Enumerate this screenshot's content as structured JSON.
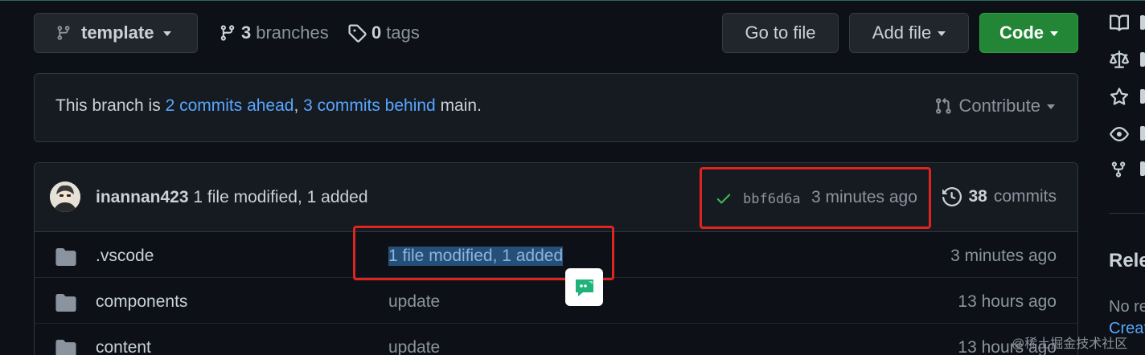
{
  "toolbar": {
    "branch_name": "template",
    "branches_count": "3",
    "branches_label": "branches",
    "tags_count": "0",
    "tags_label": "tags",
    "go_to_file": "Go to file",
    "add_file": "Add file",
    "code": "Code"
  },
  "branch_status": {
    "prefix": "This branch is ",
    "ahead": "2 commits ahead",
    "separator": ", ",
    "behind": "3 commits behind",
    "suffix": " main.",
    "contribute": "Contribute"
  },
  "latest_commit": {
    "author": "inannan423",
    "message": "1 file modified, 1 added",
    "sha": "bbf6d6a",
    "time": "3 minutes ago",
    "commits_count": "38",
    "commits_label": "commits"
  },
  "files": [
    {
      "name": ".vscode",
      "message": "1 file modified, 1 added",
      "time": "3 minutes ago"
    },
    {
      "name": "components",
      "message": "update",
      "time": "13 hours ago"
    },
    {
      "name": "content",
      "message": "update",
      "time": "13 hours ago"
    }
  ],
  "sidebar": {
    "releases_heading": "Rele",
    "no_releases": "No re",
    "create_link": "Create"
  },
  "watermark": "@稀土掘金技术社区",
  "colors": {
    "background": "#0d1117",
    "accent_link": "#58a6ff",
    "code_button": "#238636",
    "success": "#3fb950",
    "annotation_red": "#e0241f",
    "selection": "#264f78"
  },
  "icons": {
    "branch": "git-branch-icon",
    "tag": "tag-icon",
    "contribute": "pull-request-icon",
    "check": "check-icon",
    "history": "history-icon",
    "folder": "folder-icon",
    "chat": "chat-bubble-icon",
    "book": "book-icon",
    "law": "law-icon",
    "star": "star-icon",
    "eye": "eye-icon",
    "fork": "fork-icon"
  }
}
